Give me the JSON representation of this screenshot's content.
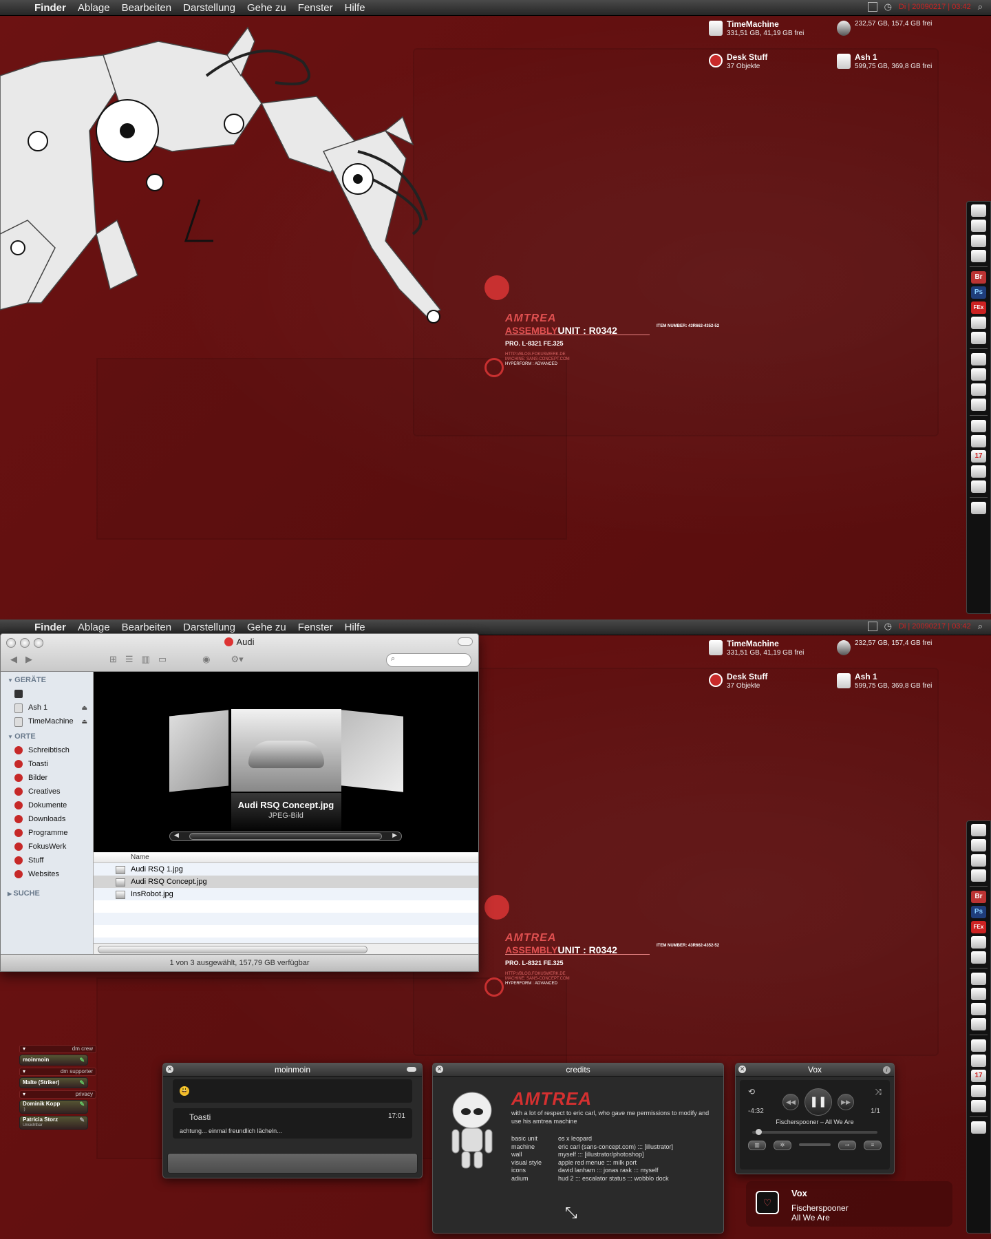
{
  "colors": {
    "desktop": "#5e0f0f",
    "accent": "#d43030",
    "menubar": "#262626"
  },
  "menubar": {
    "apple_icon": "apple-icon",
    "items": [
      "Finder",
      "Ablage",
      "Bearbeiten",
      "Darstellung",
      "Gehe zu",
      "Fenster",
      "Hilfe"
    ],
    "clock": "Di | 20090217 | 03:42"
  },
  "drives": [
    {
      "name": "TimeMachine",
      "sub": "331,51 GB, 41,19 GB frei"
    },
    {
      "name": "",
      "sub": "232,57 GB, 157,4 GB frei"
    },
    {
      "name": "Desk Stuff",
      "sub": "37 Objekte"
    },
    {
      "name": "Ash 1",
      "sub": "599,75 GB, 369,8 GB frei"
    }
  ],
  "assembly": {
    "brand": "AMTREA",
    "assembly": "ASSEMBLY",
    "unit": "UNIT : R0342",
    "item_number": "ITEM NUMBER: 43R662-4352-52",
    "pro": "PRO. L-8321 FE.325",
    "url": "HTTP://BLOG.FOKUSWERK.DE",
    "machine": "MACHINE: SANS-CONCEPT.COM",
    "hyperform": "HYPERFORM : ADVANCED"
  },
  "dock": {
    "labels": {
      "br": "Br",
      "ps": "Ps",
      "fex": "FEx",
      "cal": "17"
    }
  },
  "finder": {
    "title": "Audi",
    "sections": {
      "devices": "GERÄTE",
      "places": "ORTE",
      "search": "SUCHE"
    },
    "devices": [
      "",
      "Ash 1",
      "TimeMachine"
    ],
    "places": [
      "Schreibtisch",
      "Toasti",
      "Bilder",
      "Creatives",
      "Dokumente",
      "Downloads",
      "Programme",
      "FokusWerk",
      "Stuff",
      "Websites"
    ],
    "coverflow": {
      "name": "Audi RSQ Concept.jpg",
      "kind": "JPEG-Bild"
    },
    "column_name": "Name",
    "files": [
      "Audi RSQ 1.jpg",
      "Audi RSQ Concept.jpg",
      "InsRobot.jpg"
    ],
    "selected_index": 1,
    "status": "1 von 3 ausgewählt, 157,79 GB verfügbar"
  },
  "buddies": {
    "groups": [
      {
        "name": "",
        "label": "dm crew"
      },
      {
        "name": "",
        "label": "dm supporter"
      },
      {
        "name": "",
        "label": "privacy"
      }
    ],
    "list": [
      {
        "name": "moinmoin",
        "sub": ""
      },
      {
        "name": "Malte (Striker)",
        "sub": ""
      },
      {
        "name": "Dominik Kopp",
        "sub": ":)"
      },
      {
        "name": "Patricia Storz",
        "sub": "Unsichtbar"
      }
    ]
  },
  "chat": {
    "title": "moinmoin",
    "smiley": "😃",
    "message": {
      "who": "Toasti",
      "time": "17:01",
      "text": "achtung... einmal freundlich lächeln..."
    }
  },
  "credits": {
    "title": "credits",
    "brand": "AMTREA",
    "intro": "with a lot of respect to eric carl, who gave me permissions to modify and use his amtrea machine",
    "rows": [
      [
        "basic unit",
        "os x leopard"
      ],
      [
        "machine",
        "eric carl (sans-concept.com) ::: [illustrator]"
      ],
      [
        "wall",
        "myself ::: [illustrator/photoshop]"
      ],
      [
        "visual style",
        "apple red menue ::: milk port"
      ],
      [
        "icons",
        "david lanham ::: jonas rask ::: myself"
      ],
      [
        "adium",
        "hud 2 ::: escalator status ::: wobblo dock"
      ]
    ]
  },
  "vox": {
    "title": "Vox",
    "remaining": "-4:32",
    "count": "1/1",
    "track": "Fischerspooner – All We Are",
    "progress": 0.03
  },
  "growl": {
    "app": "Vox",
    "artist": "Fischerspooner",
    "track": "All We Are"
  }
}
